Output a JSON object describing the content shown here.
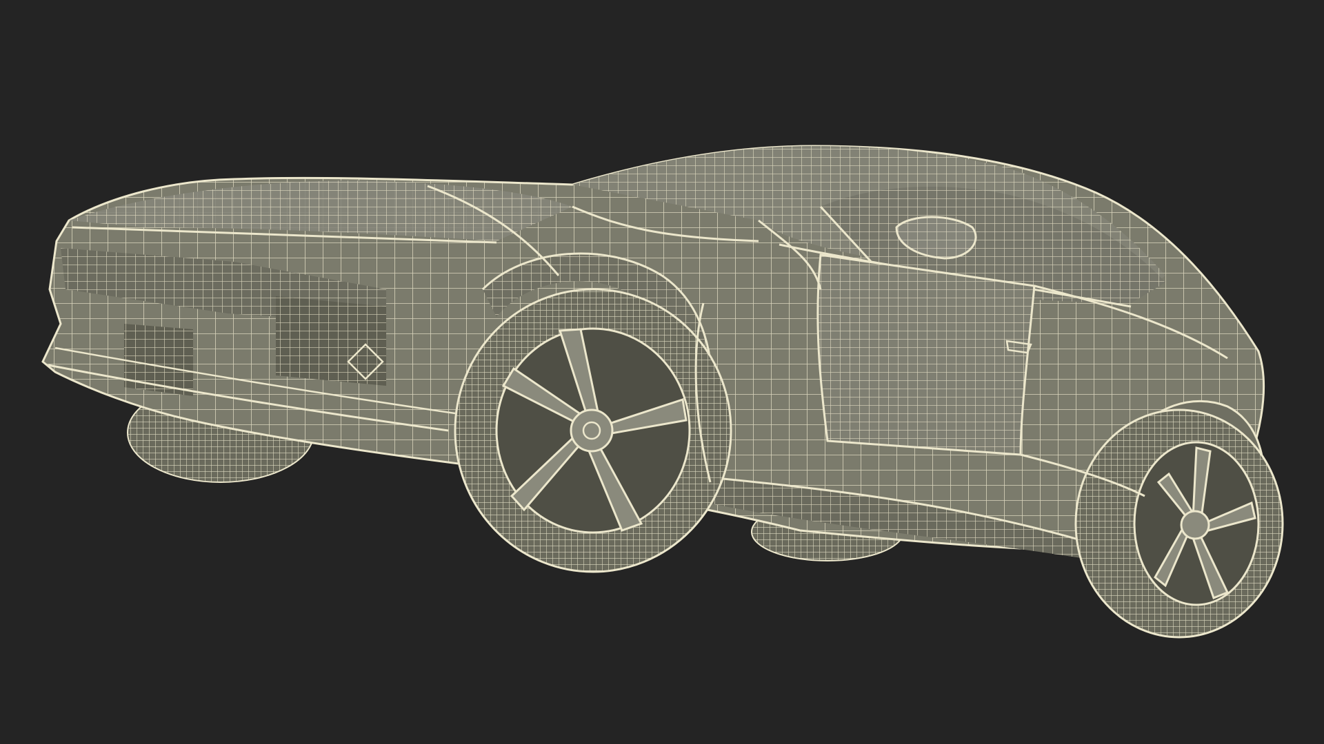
{
  "scene": {
    "subject": "car-wireframe-render",
    "colors": {
      "background": "#242424",
      "surface": "#7b7b6c",
      "surface_dark": "#5f5f52",
      "surface_shadow": "#4f4f45",
      "wire": "#ece7cc"
    }
  }
}
